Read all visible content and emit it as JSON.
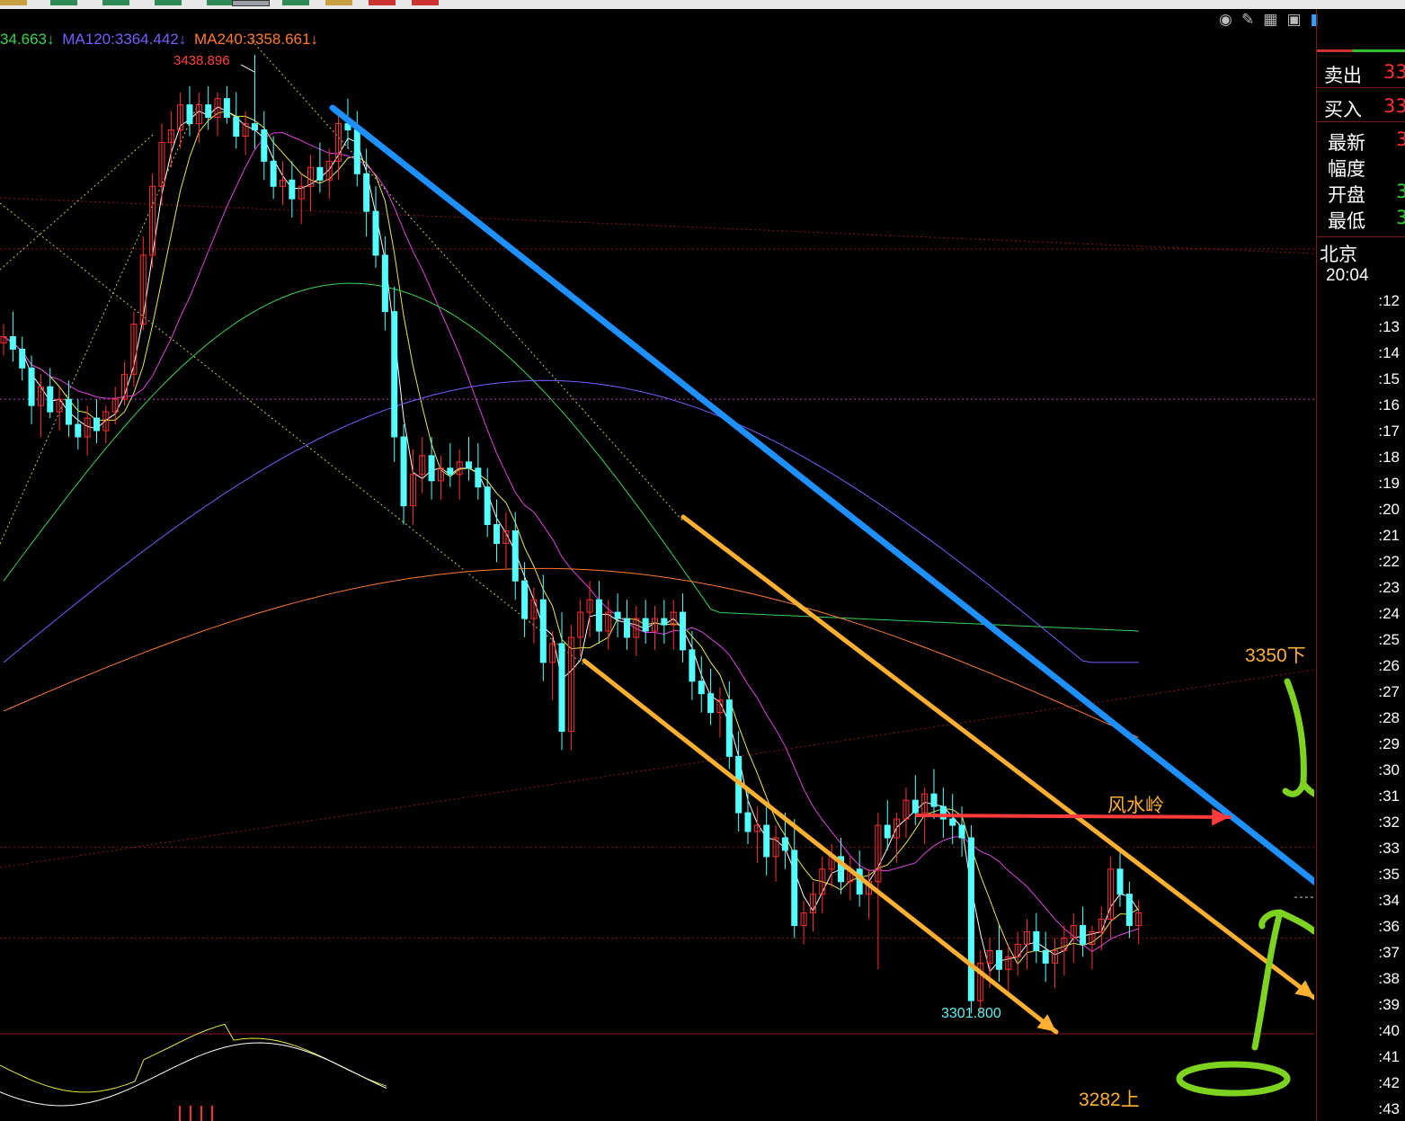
{
  "topbar": {
    "tabs": [
      {
        "color": "#c8a040"
      },
      {
        "color": "#2e8b57"
      },
      {
        "color": "#2e8b57"
      },
      {
        "color": "#2e8b57"
      },
      {
        "color": "#2e8b57"
      },
      {
        "color": "#9aa0a6"
      },
      {
        "color": "#2e8b57"
      },
      {
        "color": "#c8a040"
      },
      {
        "color": "#cc3333"
      },
      {
        "color": "#cc3333"
      }
    ]
  },
  "legend": {
    "ma_short": "34.663↓",
    "ma120": "MA120:3364.442↓",
    "ma240": "MA240:3358.661↓",
    "colors": {
      "ma_short": "#39d353",
      "ma120": "#7a5cff",
      "ma240": "#ff7a2a"
    }
  },
  "toolbar_icons": [
    "eye-hidden-icon",
    "pencil-icon",
    "grid-icon",
    "layout-icon",
    "panel-toggle-icon"
  ],
  "quote": {
    "sell_label": "卖出",
    "sell_value": "33",
    "buy_label": "买入",
    "buy_value": "33",
    "last_label": "最新",
    "last_value": "3",
    "range_label": "幅度",
    "open_label": "开盘",
    "open_value": "3",
    "low_label": "最低",
    "low_value": "3"
  },
  "ticks": {
    "city": "北京",
    "time": "20:04",
    "list": [
      ":12",
      ":13",
      ":14",
      ":15",
      ":16",
      ":17",
      ":18",
      ":19",
      ":20",
      ":21",
      ":22",
      ":23",
      ":24",
      ":25",
      ":26",
      ":27",
      ":28",
      ":29",
      ":30",
      ":31",
      ":32",
      ":33",
      ":35",
      ":34",
      ":36",
      ":37",
      ":38",
      ":39",
      ":40",
      ":41",
      ":42",
      ":43"
    ]
  },
  "annotations": {
    "high_label": "3438.896",
    "low_label": "3301.800",
    "resist_label": "3350下",
    "watershed_label": "风水岭",
    "support_label": "3282上"
  },
  "chart_data": {
    "type": "candlestick",
    "ylim": [
      3283,
      3442
    ],
    "up_color": "#ff3030",
    "down_color": "#54ffff",
    "candles": [
      [
        3393,
        3396,
        3391,
        3394
      ],
      [
        3394,
        3398,
        3390,
        3392
      ],
      [
        3392,
        3394,
        3387,
        3389
      ],
      [
        3389,
        3391,
        3380,
        3383
      ],
      [
        3383,
        3388,
        3378,
        3386
      ],
      [
        3386,
        3389,
        3381,
        3382
      ],
      [
        3382,
        3386,
        3379,
        3384
      ],
      [
        3384,
        3387,
        3378,
        3380
      ],
      [
        3380,
        3384,
        3376,
        3378
      ],
      [
        3378,
        3383,
        3375,
        3381
      ],
      [
        3381,
        3384,
        3377,
        3379
      ],
      [
        3379,
        3383,
        3377,
        3382
      ],
      [
        3382,
        3386,
        3380,
        3384
      ],
      [
        3384,
        3390,
        3383,
        3388
      ],
      [
        3388,
        3398,
        3386,
        3396
      ],
      [
        3396,
        3410,
        3395,
        3407
      ],
      [
        3407,
        3420,
        3405,
        3418
      ],
      [
        3418,
        3428,
        3415,
        3425
      ],
      [
        3425,
        3430,
        3421,
        3427
      ],
      [
        3427,
        3433,
        3424,
        3431
      ],
      [
        3431,
        3434,
        3426,
        3428
      ],
      [
        3428,
        3433,
        3425,
        3431
      ],
      [
        3431,
        3434,
        3427,
        3429
      ],
      [
        3429,
        3433,
        3426,
        3432
      ],
      [
        3432,
        3434,
        3428,
        3429
      ],
      [
        3429,
        3433,
        3424,
        3426
      ],
      [
        3426,
        3430,
        3423,
        3428
      ],
      [
        3428,
        3439,
        3424,
        3427
      ],
      [
        3427,
        3430,
        3419,
        3422
      ],
      [
        3422,
        3426,
        3416,
        3418
      ],
      [
        3418,
        3422,
        3415,
        3419
      ],
      [
        3419,
        3422,
        3413,
        3416
      ],
      [
        3416,
        3420,
        3412,
        3418
      ],
      [
        3418,
        3423,
        3414,
        3421
      ],
      [
        3421,
        3425,
        3417,
        3419
      ],
      [
        3419,
        3424,
        3416,
        3422
      ],
      [
        3422,
        3430,
        3419,
        3428
      ],
      [
        3428,
        3432,
        3424,
        3427
      ],
      [
        3427,
        3430,
        3418,
        3420
      ],
      [
        3420,
        3424,
        3410,
        3414
      ],
      [
        3414,
        3418,
        3405,
        3407
      ],
      [
        3407,
        3410,
        3395,
        3398
      ],
      [
        3398,
        3402,
        3374,
        3378
      ],
      [
        3378,
        3380,
        3364,
        3367
      ],
      [
        3367,
        3376,
        3364,
        3372
      ],
      [
        3372,
        3378,
        3369,
        3375
      ],
      [
        3375,
        3378,
        3368,
        3371
      ],
      [
        3371,
        3375,
        3368,
        3373
      ],
      [
        3373,
        3377,
        3370,
        3372
      ],
      [
        3372,
        3376,
        3368,
        3374
      ],
      [
        3374,
        3378,
        3371,
        3373
      ],
      [
        3373,
        3377,
        3368,
        3370
      ],
      [
        3370,
        3373,
        3362,
        3364
      ],
      [
        3364,
        3368,
        3358,
        3361
      ],
      [
        3361,
        3366,
        3357,
        3363
      ],
      [
        3363,
        3366,
        3352,
        3355
      ],
      [
        3355,
        3358,
        3346,
        3349
      ],
      [
        3349,
        3354,
        3345,
        3352
      ],
      [
        3352,
        3356,
        3339,
        3342
      ],
      [
        3342,
        3347,
        3336,
        3345
      ],
      [
        3345,
        3350,
        3328,
        3331
      ],
      [
        3331,
        3348,
        3328,
        3346
      ],
      [
        3346,
        3352,
        3343,
        3350
      ],
      [
        3350,
        3355,
        3346,
        3352
      ],
      [
        3352,
        3355,
        3345,
        3347
      ],
      [
        3347,
        3352,
        3344,
        3350
      ],
      [
        3350,
        3353,
        3346,
        3349
      ],
      [
        3349,
        3352,
        3344,
        3346
      ],
      [
        3346,
        3351,
        3343,
        3349
      ],
      [
        3349,
        3352,
        3345,
        3347
      ],
      [
        3347,
        3351,
        3344,
        3349
      ],
      [
        3349,
        3352,
        3345,
        3348
      ],
      [
        3348,
        3352,
        3344,
        3350
      ],
      [
        3350,
        3353,
        3342,
        3344
      ],
      [
        3344,
        3347,
        3336,
        3339
      ],
      [
        3339,
        3343,
        3334,
        3337
      ],
      [
        3337,
        3341,
        3332,
        3334
      ],
      [
        3334,
        3338,
        3330,
        3336
      ],
      [
        3336,
        3339,
        3325,
        3327
      ],
      [
        3327,
        3331,
        3315,
        3318
      ],
      [
        3318,
        3322,
        3313,
        3315
      ],
      [
        3315,
        3319,
        3310,
        3316
      ],
      [
        3316,
        3319,
        3308,
        3311
      ],
      [
        3311,
        3316,
        3307,
        3314
      ],
      [
        3314,
        3318,
        3309,
        3312
      ],
      [
        3312,
        3317,
        3298,
        3300
      ],
      [
        3300,
        3304,
        3297,
        3302
      ],
      [
        3302,
        3307,
        3299,
        3305
      ],
      [
        3305,
        3311,
        3302,
        3309
      ],
      [
        3309,
        3313,
        3306,
        3311
      ],
      [
        3311,
        3314,
        3305,
        3307
      ],
      [
        3307,
        3311,
        3304,
        3309
      ],
      [
        3309,
        3312,
        3303,
        3305
      ],
      [
        3305,
        3309,
        3301,
        3307
      ],
      [
        3307,
        3318,
        3293,
        3316
      ],
      [
        3316,
        3320,
        3312,
        3314
      ],
      [
        3314,
        3318,
        3310,
        3317
      ],
      [
        3317,
        3322,
        3314,
        3320
      ],
      [
        3320,
        3324,
        3316,
        3318
      ],
      [
        3318,
        3322,
        3313,
        3321
      ],
      [
        3321,
        3325,
        3317,
        3319
      ],
      [
        3319,
        3322,
        3314,
        3317
      ],
      [
        3317,
        3321,
        3313,
        3316
      ],
      [
        3316,
        3319,
        3311,
        3314
      ],
      [
        3314,
        3316,
        3286,
        3288
      ],
      [
        3288,
        3296,
        3286,
        3294
      ],
      [
        3294,
        3298,
        3290,
        3296
      ],
      [
        3296,
        3300,
        3291,
        3293
      ],
      [
        3293,
        3297,
        3289,
        3295
      ],
      [
        3295,
        3299,
        3292,
        3297
      ],
      [
        3297,
        3301,
        3293,
        3299
      ],
      [
        3299,
        3302,
        3294,
        3296
      ],
      [
        3296,
        3299,
        3291,
        3294
      ],
      [
        3294,
        3298,
        3290,
        3296
      ],
      [
        3296,
        3300,
        3292,
        3298
      ],
      [
        3298,
        3302,
        3294,
        3300
      ],
      [
        3300,
        3303,
        3295,
        3297
      ],
      [
        3297,
        3300,
        3293,
        3299
      ],
      [
        3299,
        3303,
        3296,
        3301
      ],
      [
        3301,
        3311,
        3298,
        3309
      ],
      [
        3309,
        3312,
        3303,
        3305
      ],
      [
        3305,
        3307,
        3298,
        3300
      ],
      [
        3300,
        3304,
        3297,
        3302
      ]
    ]
  }
}
